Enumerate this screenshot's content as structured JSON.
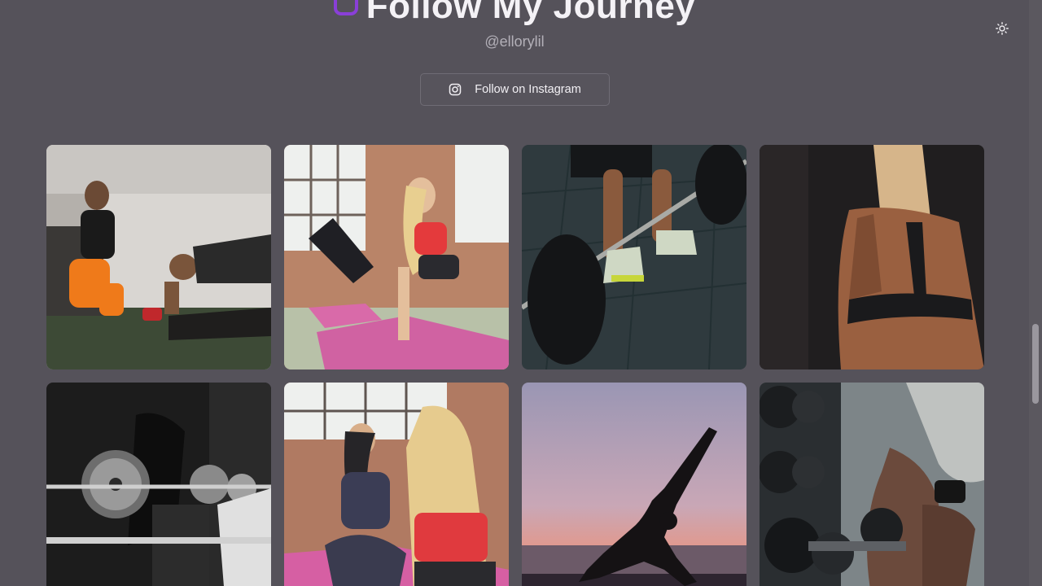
{
  "header": {
    "title": "Follow My Journey",
    "handle": "@ellorylil",
    "follow_button_label": "Follow on Instagram",
    "title_icon": "instagram-icon",
    "button_icon": "instagram-icon"
  },
  "theme_toggle": {
    "icon": "sun-icon"
  },
  "colors": {
    "background": "#55525a",
    "accent": "#8a3fd8",
    "text": "#f4f2f6",
    "muted": "#b3b0b8"
  },
  "gallery": {
    "photos": [
      {
        "subject": "trainer assisting man doing push-up exercise"
      },
      {
        "subject": "women on pink yoga mats doing leg kick exercise"
      },
      {
        "subject": "person lifting barbell in gym"
      },
      {
        "subject": "woman back view in black sports bra"
      },
      {
        "subject": "black and white woman holding weight plate"
      },
      {
        "subject": "two women chatting on yoga mats"
      },
      {
        "subject": "yoga silhouette at sunset"
      },
      {
        "subject": "man holding dumbbell near rack"
      }
    ]
  }
}
